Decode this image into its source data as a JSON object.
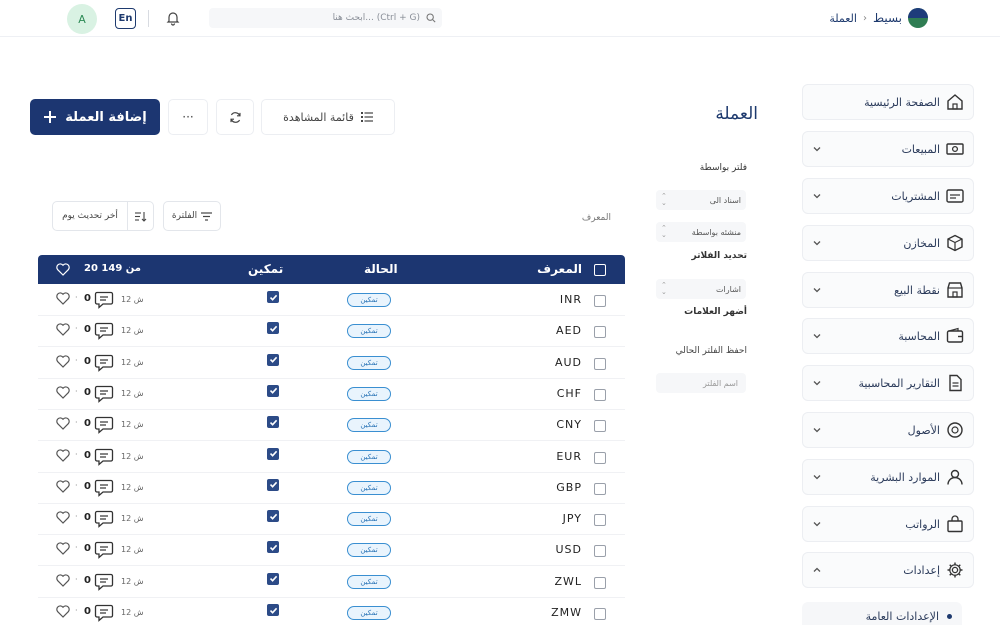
{
  "header": {
    "brand": "بسيط",
    "breadcrumb_sep": "‹",
    "breadcrumb_page": "العملة",
    "search_placeholder": "ابحث هنا... (Ctrl + G)",
    "lang": "En",
    "avatar": "A"
  },
  "sidebar": {
    "items": [
      {
        "label": "الصفحة الرئيسية",
        "icon": "home-icon",
        "chevron": false
      },
      {
        "label": "المبيعات",
        "icon": "cash-icon",
        "chevron": true
      },
      {
        "label": "المشتريات",
        "icon": "card-icon",
        "chevron": true
      },
      {
        "label": "المخازن",
        "icon": "box-icon",
        "chevron": true
      },
      {
        "label": "نقطة البيع",
        "icon": "store-icon",
        "chevron": true
      },
      {
        "label": "المحاسبة",
        "icon": "wallet-icon",
        "chevron": true
      },
      {
        "label": "التقارير المحاسبية",
        "icon": "report-icon",
        "chevron": true
      },
      {
        "label": "الأصول",
        "icon": "asset-icon",
        "chevron": true
      },
      {
        "label": "الموارد البشرية",
        "icon": "user-icon",
        "chevron": true
      },
      {
        "label": "الرواتب",
        "icon": "bag-icon",
        "chevron": true
      },
      {
        "label": "إعدادات",
        "icon": "gear-icon",
        "chevron": true,
        "expanded": true
      }
    ],
    "sub_item": "الإعدادات العامة"
  },
  "page": {
    "title": "العملة",
    "add_button": "إضافة العملة",
    "more_button": "···",
    "watchlist_button": "قائمة المشاهدة"
  },
  "filters": {
    "heading": "فلتر بواسطة",
    "assigned_to": "اسناد الى",
    "created_by": "منشئه بواسطة",
    "set_filters": "تحديد الفلاتر",
    "tags": "اشارات",
    "show_tags": "أضهر العلامات",
    "save_current": "احفظ الفلتر الحالي",
    "filter_name_placeholder": "اسم الفلتر"
  },
  "table_tools": {
    "identifier_caption": "المعرف",
    "filter_button": "الفلترة",
    "sort_label": "أخر تحديث يوم"
  },
  "table": {
    "headers": {
      "id": "المعرف",
      "status": "الحالة",
      "enabled": "تمكين",
      "count": "20 من 149"
    },
    "rows": [
      {
        "code": "INR",
        "status": "تمكين",
        "time": "12 ش",
        "comments": "0",
        "dot": "·"
      },
      {
        "code": "AED",
        "status": "تمكين",
        "time": "12 ش",
        "comments": "0",
        "dot": "·"
      },
      {
        "code": "AUD",
        "status": "تمكين",
        "time": "12 ش",
        "comments": "0",
        "dot": "·"
      },
      {
        "code": "CHF",
        "status": "تمكين",
        "time": "12 ش",
        "comments": "0",
        "dot": "·"
      },
      {
        "code": "CNY",
        "status": "تمكين",
        "time": "12 ش",
        "comments": "0",
        "dot": "·"
      },
      {
        "code": "EUR",
        "status": "تمكين",
        "time": "12 ش",
        "comments": "0",
        "dot": "·"
      },
      {
        "code": "GBP",
        "status": "تمكين",
        "time": "12 ش",
        "comments": "0",
        "dot": "·"
      },
      {
        "code": "JPY",
        "status": "تمكين",
        "time": "12 ش",
        "comments": "0",
        "dot": "·"
      },
      {
        "code": "USD",
        "status": "تمكين",
        "time": "12 ش",
        "comments": "0",
        "dot": "·"
      },
      {
        "code": "ZWL",
        "status": "تمكين",
        "time": "12 ش",
        "comments": "0",
        "dot": "·"
      },
      {
        "code": "ZMW",
        "status": "تمكين",
        "time": "12 ش",
        "comments": "0",
        "dot": "·"
      }
    ]
  },
  "colors": {
    "primary": "#1c3671",
    "badge_border": "#3a8fd1",
    "badge_bg": "#e9f4fd"
  }
}
